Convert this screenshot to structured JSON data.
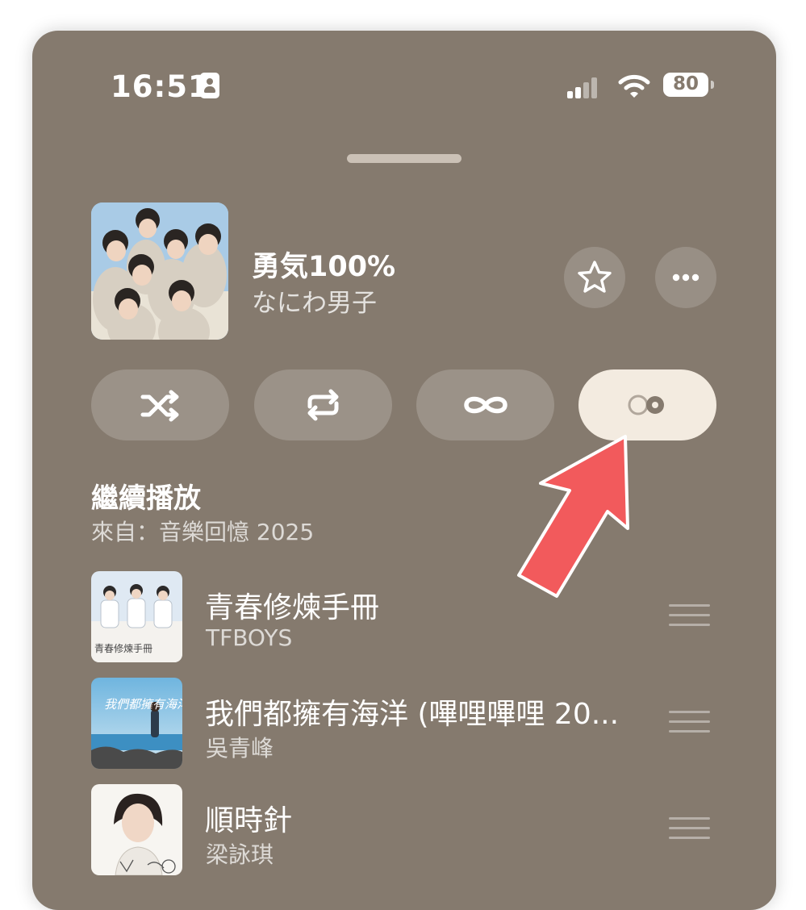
{
  "status_bar": {
    "time": "16:51",
    "battery": "80",
    "icons": [
      "contact-card-icon",
      "cellular-signal-icon",
      "wifi-icon",
      "battery-icon"
    ]
  },
  "now_playing": {
    "title": "勇気100%",
    "artist": "なにわ男子",
    "favorite_icon": "star-icon",
    "more_icon": "ellipsis-icon"
  },
  "controls": [
    {
      "name": "shuffle",
      "icon": "shuffle-icon",
      "active": false
    },
    {
      "name": "repeat",
      "icon": "repeat-icon",
      "active": false
    },
    {
      "name": "autoplay",
      "icon": "infinity-icon",
      "active": false
    },
    {
      "name": "crossfade",
      "icon": "crossfade-icon",
      "active": true
    }
  ],
  "queue": {
    "heading": "繼續播放",
    "source": "來自：音樂回憶 2025",
    "items": [
      {
        "title": "青春修煉手冊",
        "artist": "TFBOYS"
      },
      {
        "title": "我們都擁有海洋 (嗶哩嗶哩 20...",
        "artist": "吳青峰"
      },
      {
        "title": "順時針",
        "artist": "梁詠琪"
      }
    ]
  },
  "album_art_text": {
    "item_0": "青春修煉手冊",
    "item_1": "我們都擁有海洋"
  },
  "colors": {
    "background": "#857a6e",
    "active_control": "#f3ebe0",
    "annotation_arrow": "#f25a5c"
  }
}
